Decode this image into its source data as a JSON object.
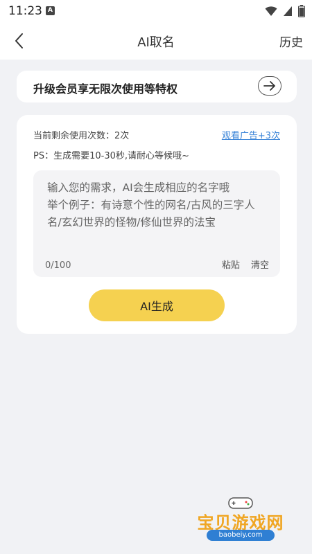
{
  "status_bar": {
    "time": "11:23",
    "notification_icon": "A"
  },
  "header": {
    "title": "AI取名",
    "history_label": "历史"
  },
  "vip_banner": {
    "text": "升级会员享无限次使用等特权"
  },
  "card": {
    "remaining_text": "当前剩余使用次数：2次",
    "watch_ad_label": "观看广告+3次",
    "ps_text": "PS：生成需要10-30秒,请耐心等候哦~",
    "input": {
      "value": "",
      "placeholder": "输入您的需求，AI会生成相应的名字哦\n举个例子：有诗意个性的网名/古风的三字人名/玄幻世界的怪物/修仙世界的法宝",
      "counter": "0/100",
      "paste_label": "粘贴",
      "clear_label": "清空"
    },
    "generate_label": "AI生成"
  },
  "watermark": {
    "text": "宝贝游戏网",
    "url": "baobeiy.com"
  },
  "colors": {
    "accent": "#f5d150",
    "link": "#3a84d8",
    "background": "#f1f2f5"
  }
}
